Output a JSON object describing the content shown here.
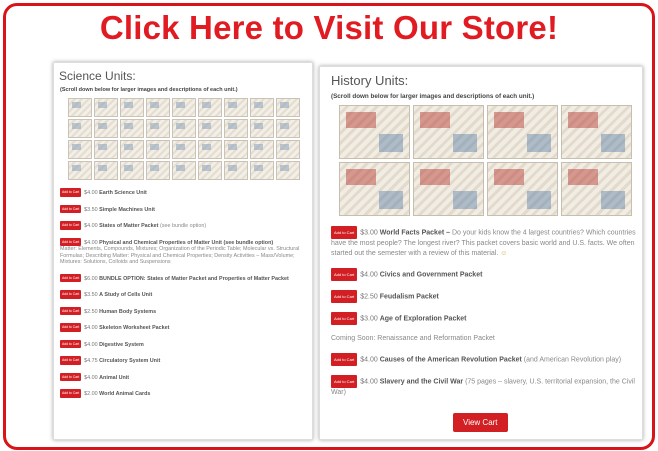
{
  "banner": {
    "headline": "Click Here to Visit Our Store!"
  },
  "science": {
    "title": "Science Units:",
    "subtitle": "(Scroll down below for larger images and descriptions of each unit.)",
    "items": [
      {
        "button": "Add to Cart",
        "price": "$4.00",
        "title": "Earth Science Unit",
        "desc": ""
      },
      {
        "button": "Add to Cart",
        "price": "$3.50",
        "title": "Simple Machines Unit",
        "desc": ""
      },
      {
        "button": "Add to Cart",
        "price": "$4.00",
        "title": "States of Matter Packet",
        "desc": "(see bundle option)"
      },
      {
        "button": "Add to Cart",
        "price": "$4.00",
        "title": "Physical and Chemical Properties of Matter Unit (see bundle option)",
        "desc": "Matter: Elements, Compounds, Mixtures; Organization of the Periodic Table; Molecular vs. Structural Formulas; Describing Matter: Physical and Chemical Properties; Density Activities – Mass/Volume; Mixtures: Solutions, Colloids and Suspensions"
      },
      {
        "button": "Add to Cart",
        "price": "$6.00",
        "title": "BUNDLE OPTION: States of Matter Packet and Properties of Matter Packet",
        "desc": ""
      },
      {
        "button": "Add to Cart",
        "price": "$3.50",
        "title": "A Study of Cells Unit",
        "desc": ""
      },
      {
        "button": "Add to Cart",
        "price": "$2.50",
        "title": "Human Body Systems",
        "desc": ""
      },
      {
        "button": "Add to Cart",
        "price": "$4.00",
        "title": "Skeleton Worksheet Packet",
        "desc": ""
      },
      {
        "button": "Add to Cart",
        "price": "$4.00",
        "title": "Digestive System",
        "desc": ""
      },
      {
        "button": "Add to Cart",
        "price": "$4.75",
        "title": "Circulatory System Unit",
        "desc": ""
      },
      {
        "button": "Add to Cart",
        "price": "$4.00",
        "title": "Animal Unit",
        "desc": ""
      },
      {
        "button": "Add to Cart",
        "price": "$2.00",
        "title": "World Animal Cards",
        "desc": ""
      }
    ]
  },
  "history": {
    "title": "History Units:",
    "subtitle": "(Scroll down below for larger images and descriptions of each unit.)",
    "items": [
      {
        "button": "Add to Cart",
        "price": "$3.00",
        "title": "World Facts Packet –",
        "desc": "Do your kids know the 4 largest countries? Which countries have the most people? The longest river? This packet covers basic world and U.S. facts. We often started out the semester with a review of this material."
      },
      {
        "button": "Add to Cart",
        "price": "$4.00",
        "title": "Civics and Government Packet",
        "desc": ""
      },
      {
        "button": "Add to Cart",
        "price": "$2.50",
        "title": "Feudalism Packet",
        "desc": ""
      },
      {
        "button": "Add to Cart",
        "price": "$3.00",
        "title": "Age of Exploration Packet",
        "desc": ""
      },
      {
        "button": "Add to Cart",
        "price": "$4.00",
        "title": "Causes of the American Revolution Packet",
        "desc": "(and American Revolution play)"
      },
      {
        "button": "Add to Cart",
        "price": "$4.00",
        "title": "Slavery and the Civil War",
        "desc": "(75 pages – slavery, U.S. territorial expansion, the Civil War)"
      }
    ],
    "coming_soon": "Coming Soon: Renaissance and Reformation Packet",
    "view_cart": "View Cart",
    "smile_icon": "☺"
  },
  "colors": {
    "brand_red": "#e01b22",
    "button_red": "#d11f24"
  }
}
